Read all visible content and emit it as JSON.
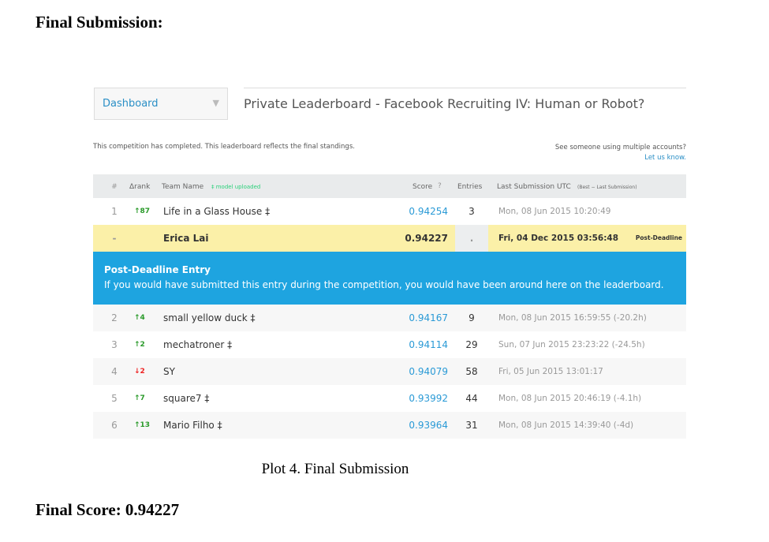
{
  "heading": "Final Submission:",
  "screenshot": {
    "dashboard": "Dashboard",
    "title": "Private Leaderboard - Facebook Recruiting IV: Human or Robot?",
    "info": "This competition has completed. This leaderboard reflects the final standings.",
    "multi_q": "See someone using multiple accounts?",
    "multi_link": "Let us know.",
    "header": {
      "rank": "#",
      "delta": "Δrank",
      "team": "Team Name",
      "model": "‡ model uploaded",
      "score": "Score",
      "entries": "Entries",
      "last": "Last Submission UTC",
      "last_sub": "(Best − Last Submission)"
    },
    "row1": {
      "rank": "1",
      "delta": "↑87",
      "team": "Life in a Glass House ‡",
      "score": "0.94254",
      "entries": "3",
      "last": "Mon, 08 Jun 2015 10:20:49"
    },
    "erica": {
      "rank": "-",
      "team": "Erica Lai",
      "score": "0.94227",
      "entries": ".",
      "last": "Fri, 04 Dec 2015 03:56:48",
      "tag": "Post-Deadline"
    },
    "banner": {
      "title": "Post-Deadline Entry",
      "text": "If you would have submitted this entry during the competition, you would have been around here on the leaderboard."
    },
    "rows": [
      {
        "rank": "2",
        "delta": "↑4",
        "team": "small yellow duck ‡",
        "score": "0.94167",
        "entries": "9",
        "last": "Mon, 08 Jun 2015 16:59:55 (-20.2h)"
      },
      {
        "rank": "3",
        "delta": "↑2",
        "team": "mechatroner ‡",
        "score": "0.94114",
        "entries": "29",
        "last": "Sun, 07 Jun 2015 23:23:22 (-24.5h)"
      },
      {
        "rank": "4",
        "delta": "↓2",
        "team": "SY",
        "score": "0.94079",
        "entries": "58",
        "last": "Fri, 05 Jun 2015 13:01:17"
      },
      {
        "rank": "5",
        "delta": "↑7",
        "team": "square7 ‡",
        "score": "0.93992",
        "entries": "44",
        "last": "Mon, 08 Jun 2015 20:46:19 (-4.1h)"
      },
      {
        "rank": "6",
        "delta": "↑13",
        "team": "Mario Filho ‡",
        "score": "0.93964",
        "entries": "31",
        "last": "Mon, 08 Jun 2015 14:39:40 (-4d)"
      }
    ]
  },
  "caption": "Plot 4. Final Submission",
  "final_score": "Final Score: 0.94227"
}
